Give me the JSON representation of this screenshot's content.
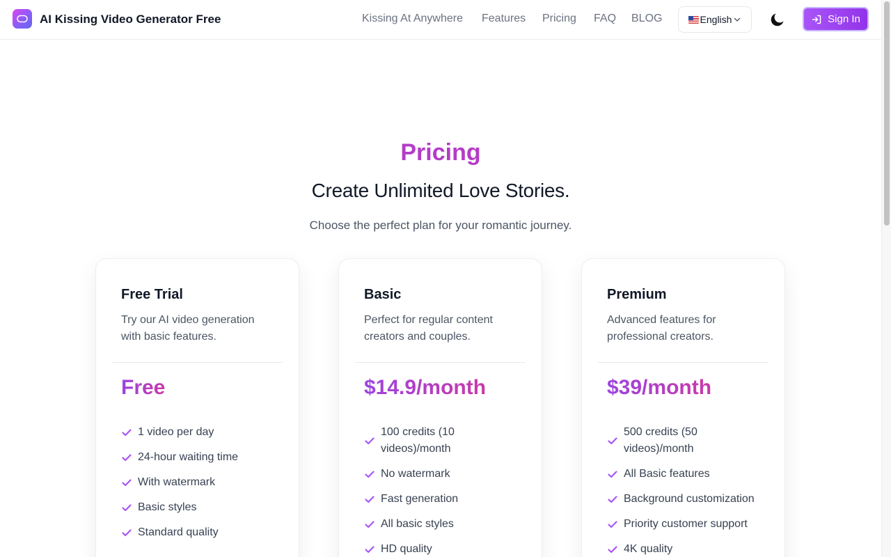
{
  "header": {
    "brand": "AI Kissing Video Generator Free",
    "nav": [
      {
        "label": "Kissing At Anywhere"
      },
      {
        "label": "Features"
      },
      {
        "label": "Pricing"
      },
      {
        "label": "FAQ"
      },
      {
        "label": "BLOG"
      }
    ],
    "language": "English",
    "sign_in": "Sign In"
  },
  "pricing": {
    "label": "Pricing",
    "headline": "Create Unlimited Love Stories.",
    "subline": "Choose the perfect plan for your romantic journey.",
    "plans": [
      {
        "name": "Free Trial",
        "description": "Try our AI video generation with basic features.",
        "price": "Free",
        "features": [
          "1 video per day",
          "24-hour waiting time",
          "With watermark",
          "Basic styles",
          "Standard quality"
        ]
      },
      {
        "name": "Basic",
        "description": "Perfect for regular content creators and couples.",
        "price": "$14.9/month",
        "features": [
          "100 credits (10 videos)/month",
          "No watermark",
          "Fast generation",
          "All basic styles",
          "HD quality"
        ]
      },
      {
        "name": "Premium",
        "description": "Advanced features for professional creators.",
        "price": "$39/month",
        "features": [
          "500 credits (50 videos)/month",
          "All Basic features",
          "Background customization",
          "Priority customer support",
          "4K quality"
        ]
      }
    ]
  },
  "colors": {
    "accent": "#a855f7",
    "check": "#a855f7",
    "price_gradient_start": "#9d44e0",
    "price_gradient_end": "#c93aa8"
  },
  "icons": {
    "logo": "heart-logo-icon",
    "theme": "moon-icon",
    "sign_in": "sign-in-icon",
    "language": "us-flag-icon",
    "dropdown": "chevron-down-icon",
    "feature": "check-icon"
  }
}
